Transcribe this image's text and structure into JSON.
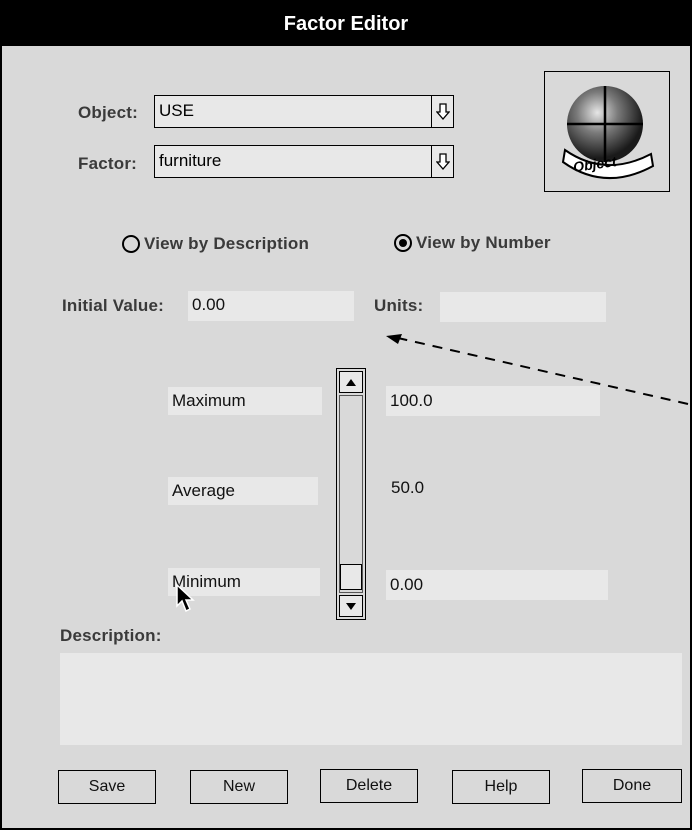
{
  "window": {
    "title": "Factor Editor"
  },
  "object": {
    "label": "Object:",
    "value": "USE"
  },
  "factor": {
    "label": "Factor:",
    "value": "furniture"
  },
  "logo": {
    "text": "Object"
  },
  "view_mode": {
    "by_description": {
      "label": "View by Description",
      "selected": false
    },
    "by_number": {
      "label": "View by Number",
      "selected": true
    }
  },
  "initial_value": {
    "label": "Initial Value:",
    "value": "0.00"
  },
  "units": {
    "label": "Units:",
    "value": ""
  },
  "range": {
    "maximum_label": "Maximum",
    "maximum_value": "100.0",
    "average_label": "Average",
    "average_value": "50.0",
    "minimum_label": "Minimum",
    "minimum_value": "0.00"
  },
  "description": {
    "label": "Description:",
    "value": ""
  },
  "buttons": {
    "save": "Save",
    "new": "New",
    "delete": "Delete",
    "help": "Help",
    "done": "Done"
  }
}
